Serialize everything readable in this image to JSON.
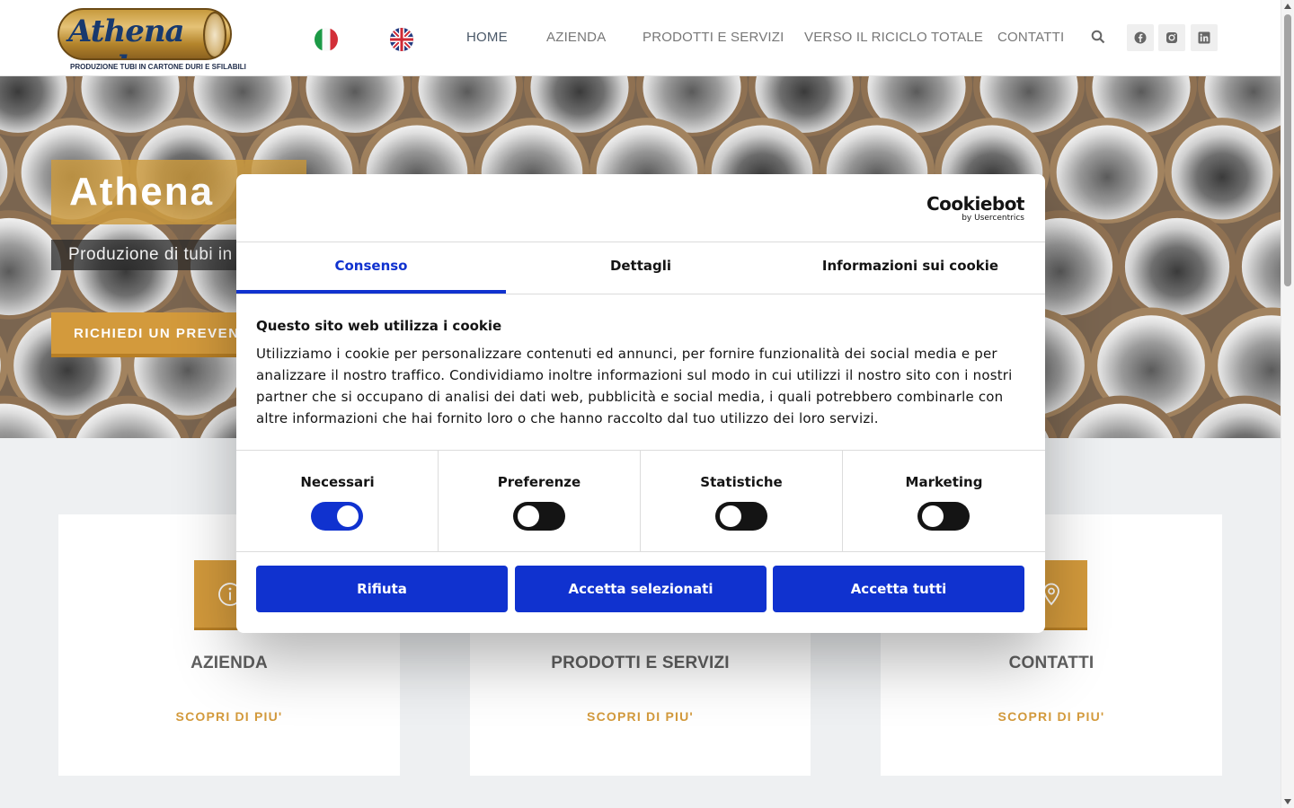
{
  "header": {
    "logo_text": "Athena s.r.l.",
    "logo_tagline": "PRODUZIONE TUBI IN CARTONE DURI E SFILABILI",
    "flags": {
      "it": "italian-flag",
      "en": "uk-flag"
    },
    "nav": [
      {
        "label": "HOME",
        "active": true
      },
      {
        "label": "AZIENDA",
        "active": false
      },
      {
        "label": "PRODOTTI E SERVIZI",
        "active": false
      },
      {
        "label": "VERSO IL RICICLO TOTALE",
        "active": false
      },
      {
        "label": "CONTATTI",
        "active": false
      }
    ],
    "social_icons": [
      "facebook-icon",
      "instagram-icon",
      "linkedin-icon"
    ]
  },
  "hero": {
    "title": "Athena",
    "subtitle": "Produzione di tubi in",
    "cta": "RICHIEDI UN PREVENT"
  },
  "cards": [
    {
      "title": "AZIENDA",
      "link": "SCOPRI DI PIU'",
      "icon": "info-icon"
    },
    {
      "title": "PRODOTTI E SERVIZI",
      "link": "SCOPRI DI PIU'",
      "icon": "box-icon"
    },
    {
      "title": "CONTATTI",
      "link": "SCOPRI DI PIU'",
      "icon": "location-pin-icon"
    }
  ],
  "cookie_dialog": {
    "brand": "Cookiebot",
    "brand_by": "by Usercentrics",
    "tabs": [
      {
        "label": "Consenso",
        "active": true
      },
      {
        "label": "Dettagli",
        "active": false
      },
      {
        "label": "Informazioni sui cookie",
        "active": false
      }
    ],
    "heading": "Questo sito web utilizza i cookie",
    "body": "Utilizziamo i cookie per personalizzare contenuti ed annunci, per fornire funzionalità dei social media e per analizzare il nostro traffico. Condividiamo inoltre informazioni sul modo in cui utilizzi il nostro sito con i nostri partner che si occupano di analisi dei dati web, pubblicità e social media, i quali potrebbero combinarle con altre informazioni che hai fornito loro o che hanno raccolto dal tuo utilizzo dei loro servizi.",
    "toggles": [
      {
        "label": "Necessari",
        "on": true
      },
      {
        "label": "Preferenze",
        "on": false
      },
      {
        "label": "Statistiche",
        "on": false
      },
      {
        "label": "Marketing",
        "on": false
      }
    ],
    "buttons": {
      "reject": "Rifiuta",
      "accept_selected": "Accetta selezionati",
      "accept_all": "Accetta tutti"
    }
  },
  "colors": {
    "accent_gold": "#d39a3c",
    "cookiebot_blue": "#1032cf",
    "nav_text": "#777777"
  }
}
